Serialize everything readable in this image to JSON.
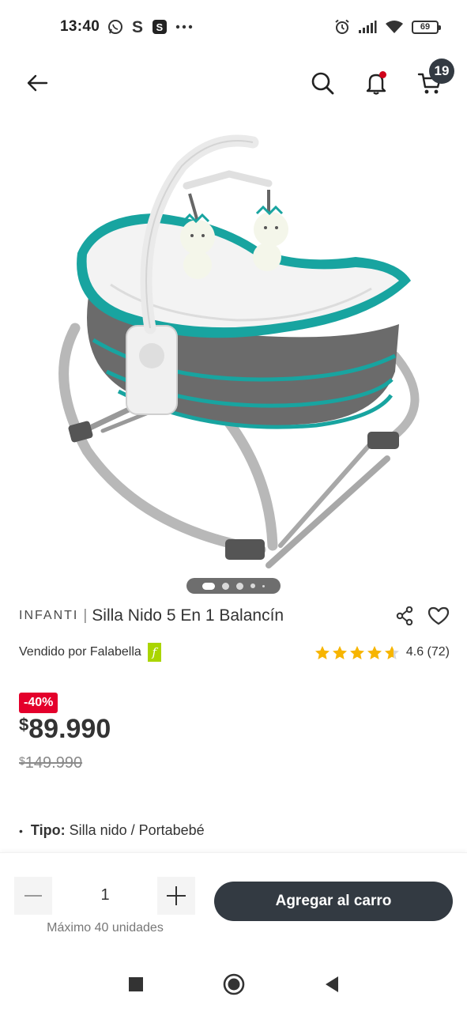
{
  "status_bar": {
    "time": "13:40",
    "battery": "69",
    "icons": [
      "whatsapp-icon",
      "s-app-icon",
      "s-dark-app-icon",
      "more-dots-icon",
      "alarm-icon",
      "signal-icon",
      "wifi-icon",
      "battery-icon"
    ]
  },
  "header": {
    "cart_count": "19"
  },
  "carousel": {
    "total_dots": 5,
    "active_index": 0
  },
  "product": {
    "brand": "INFANTI",
    "separator": "|",
    "name": "Silla Nido 5 En 1 Balancín",
    "seller_text": "Vendido por Falabella",
    "seller_logo": "f",
    "rating_value": 4.6,
    "rating_text": "4.6 (72)",
    "discount": "-40%",
    "price_currency": "$",
    "price": "89.990",
    "old_price_currency": "$",
    "old_price": "149.990",
    "spec_bullet": "•",
    "spec_label": "Tipo:",
    "spec_value": "Silla nido / Portabebé"
  },
  "actions": {
    "quantity": "1",
    "max_units": "Máximo 40 unidades",
    "add_to_cart": "Agregar al carro"
  },
  "colors": {
    "accent_dark": "#333a42",
    "discount_red": "#e4002b",
    "star_yellow": "#f7b500",
    "falabella_green": "#aad500",
    "teal": "#1aa3a0"
  }
}
